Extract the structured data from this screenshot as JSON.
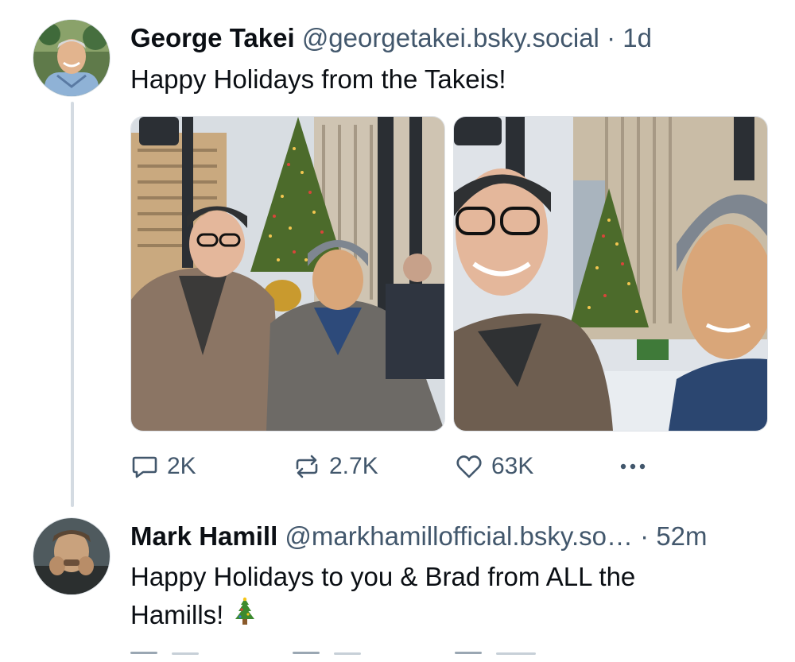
{
  "posts": [
    {
      "author": {
        "display_name": "George Takei",
        "handle": "@georgetakei.bsky.social"
      },
      "separator": "·",
      "timestamp": "1d",
      "text": "Happy Holidays from the Takeis!",
      "images": [
        {
          "icon": "photo-selfie-rockefeller-tree"
        },
        {
          "icon": "photo-closeup-selfie-tree"
        }
      ],
      "actions": {
        "reply": {
          "icon": "reply-icon",
          "count": "2K"
        },
        "repost": {
          "icon": "repost-icon",
          "count": "2.7K"
        },
        "like": {
          "icon": "heart-icon",
          "count": "63K"
        },
        "more": {
          "icon": "more-icon"
        }
      }
    },
    {
      "author": {
        "display_name": "Mark Hamill",
        "handle": "@markhamillofficial.bsky.so…"
      },
      "separator": "·",
      "timestamp": "52m",
      "text_line1": "Happy Holidays to you & Brad from ALL the",
      "text_line2": "Hamills!",
      "emoji": "christmas-tree-emoji"
    }
  ],
  "colors": {
    "text_primary": "#0b0f14",
    "text_secondary": "#42576c",
    "thread_line": "#d4dbe2",
    "border": "#dfe3e8"
  }
}
